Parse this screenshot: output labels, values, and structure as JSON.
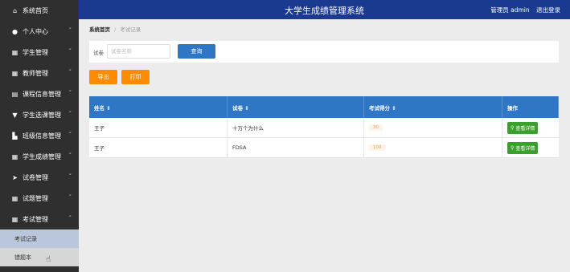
{
  "header": {
    "title": "大学生成绩管理系统",
    "user": "管理员 admin",
    "logout": "退出登录"
  },
  "sidebar": {
    "items": [
      {
        "label": "系统首页",
        "icon": "home-icon",
        "chev": ""
      },
      {
        "label": "个人中心",
        "icon": "user-icon",
        "chev": "˅"
      },
      {
        "label": "学生管理",
        "icon": "grid-icon",
        "chev": "˅"
      },
      {
        "label": "教师管理",
        "icon": "grid-icon",
        "chev": "˅"
      },
      {
        "label": "课程信息管理",
        "icon": "doc-icon",
        "chev": "˅"
      },
      {
        "label": "学生选课管理",
        "icon": "comment-icon",
        "chev": "˅"
      },
      {
        "label": "班级信息管理",
        "icon": "building-icon",
        "chev": "˅"
      },
      {
        "label": "学生成绩管理",
        "icon": "grid-icon",
        "chev": "˅"
      },
      {
        "label": "试卷管理",
        "icon": "send-icon",
        "chev": "˅"
      },
      {
        "label": "试题管理",
        "icon": "grid-icon",
        "chev": "˅"
      },
      {
        "label": "考试管理",
        "icon": "grid-icon",
        "chev": "˄"
      }
    ],
    "sub": [
      "考试记录",
      "错题本"
    ]
  },
  "breadcrumb": {
    "home": "系统首页",
    "current": "考试记录"
  },
  "search": {
    "label": "试卷",
    "placeholder": "试卷名称",
    "button": "查询"
  },
  "actions": {
    "export": "导出",
    "print": "打印"
  },
  "table": {
    "headers": [
      "姓名 ⇕",
      "试卷 ⇕",
      "考试得分 ⇕",
      "操作"
    ],
    "rows": [
      {
        "name": "王子",
        "paper": "十万个为什么",
        "score": "30",
        "action": "查看详情"
      },
      {
        "name": "王子",
        "paper": "FDSA",
        "score": "100",
        "action": "查看详情"
      }
    ]
  },
  "colors": {
    "sidebar": "#2f2f2f",
    "topbar": "#1a3a8f",
    "primary": "#2f76c4",
    "orange": "#ff8c00",
    "green": "#3aa02c"
  }
}
